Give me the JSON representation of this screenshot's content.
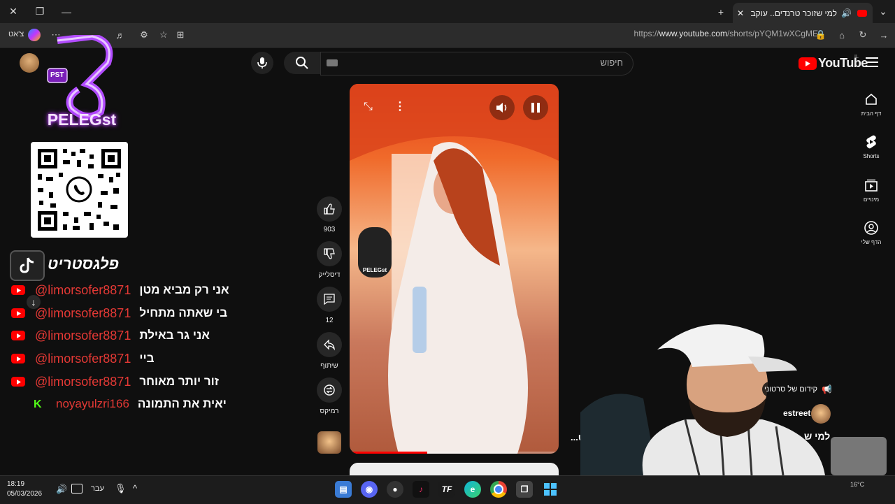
{
  "browser": {
    "tab_title": "למי שזוכר טרנדים.. עוקב = כסף",
    "url_prefix": "https://",
    "url_domain": "www.youtube.com",
    "url_path": "/shorts/pYQM1wXCgME",
    "profile_label": "צ'אט"
  },
  "youtube": {
    "logo_text": "YouTube",
    "region": "IL",
    "search_placeholder": "חיפוש",
    "nav": [
      {
        "label": "דף הבית",
        "icon": "home-icon"
      },
      {
        "label": "Shorts",
        "icon": "shorts-icon"
      },
      {
        "label": "מינויים",
        "icon": "subscriptions-icon"
      },
      {
        "label": "הדף שלי",
        "icon": "account-icon"
      }
    ],
    "actions": {
      "like_count": "903",
      "dislike_label": "דיסלייק",
      "comment_count": "12",
      "share_label": "שיתוף",
      "remix_label": "רמיקס"
    },
    "video_watermark": "PELEGst",
    "video_caption_tail": "ריט...",
    "promo_text": "קידום של סרטוני",
    "channel_partial": "estreet",
    "title_partial": "למי ש"
  },
  "overlay": {
    "logo_text": "PELEGst",
    "logo_badge": "PST",
    "brand_hebrew": "פלגסטריט",
    "chat": [
      {
        "user": "@limorsofer8871",
        "message": "אני רק מביא מטן",
        "source": "youtube"
      },
      {
        "user": "@limorsofer8871",
        "message": "בי שאתה מתחיל",
        "source": "youtube"
      },
      {
        "user": "@limorsofer8871",
        "message": "אני גר באילת",
        "source": "youtube"
      },
      {
        "user": "@limorsofer8871",
        "message": "ביי",
        "source": "youtube"
      },
      {
        "user": "@limorsofer8871",
        "message": "זור יותר מאוחר",
        "source": "youtube"
      },
      {
        "user": "noyayulzri166",
        "message": "יאית את התמונה",
        "source": "kick"
      }
    ]
  },
  "taskbar": {
    "time": "18:19",
    "date": "05/03/2026",
    "lang": "עבר",
    "weather": "16°C"
  },
  "colors": {
    "yt_red": "#ff0000",
    "chat_name": "#e53935",
    "kick_green": "#53fc18"
  }
}
